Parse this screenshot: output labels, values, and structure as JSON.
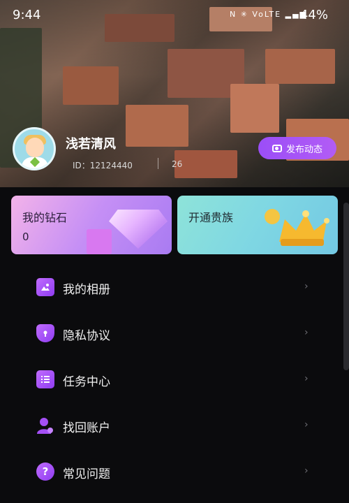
{
  "status": {
    "time": "9:44",
    "battery": "44%",
    "icons": [
      "nfc-icon",
      "vibrate-icon",
      "volte-icon",
      "signal-icon"
    ]
  },
  "profile": {
    "username": "浅若清风",
    "id_text": "ID：12124440",
    "count": "26",
    "post_button": "发布动态"
  },
  "cards": {
    "diamond": {
      "title": "我的钻石",
      "value": "0"
    },
    "noble": {
      "title": "开通贵族"
    }
  },
  "menu": [
    {
      "label": "我的相册",
      "icon": "photo-album-icon"
    },
    {
      "label": "隐私协议",
      "icon": "privacy-shield-icon"
    },
    {
      "label": "任务中心",
      "icon": "task-list-icon"
    },
    {
      "label": "找回账户",
      "icon": "recover-account-icon"
    },
    {
      "label": "常见问题",
      "icon": "question-icon"
    }
  ],
  "colors": {
    "accent": "#9b4ef7",
    "background": "#0b0b0d",
    "diamond_card": "#c58ff5",
    "noble_card": "#7fd7e3"
  }
}
